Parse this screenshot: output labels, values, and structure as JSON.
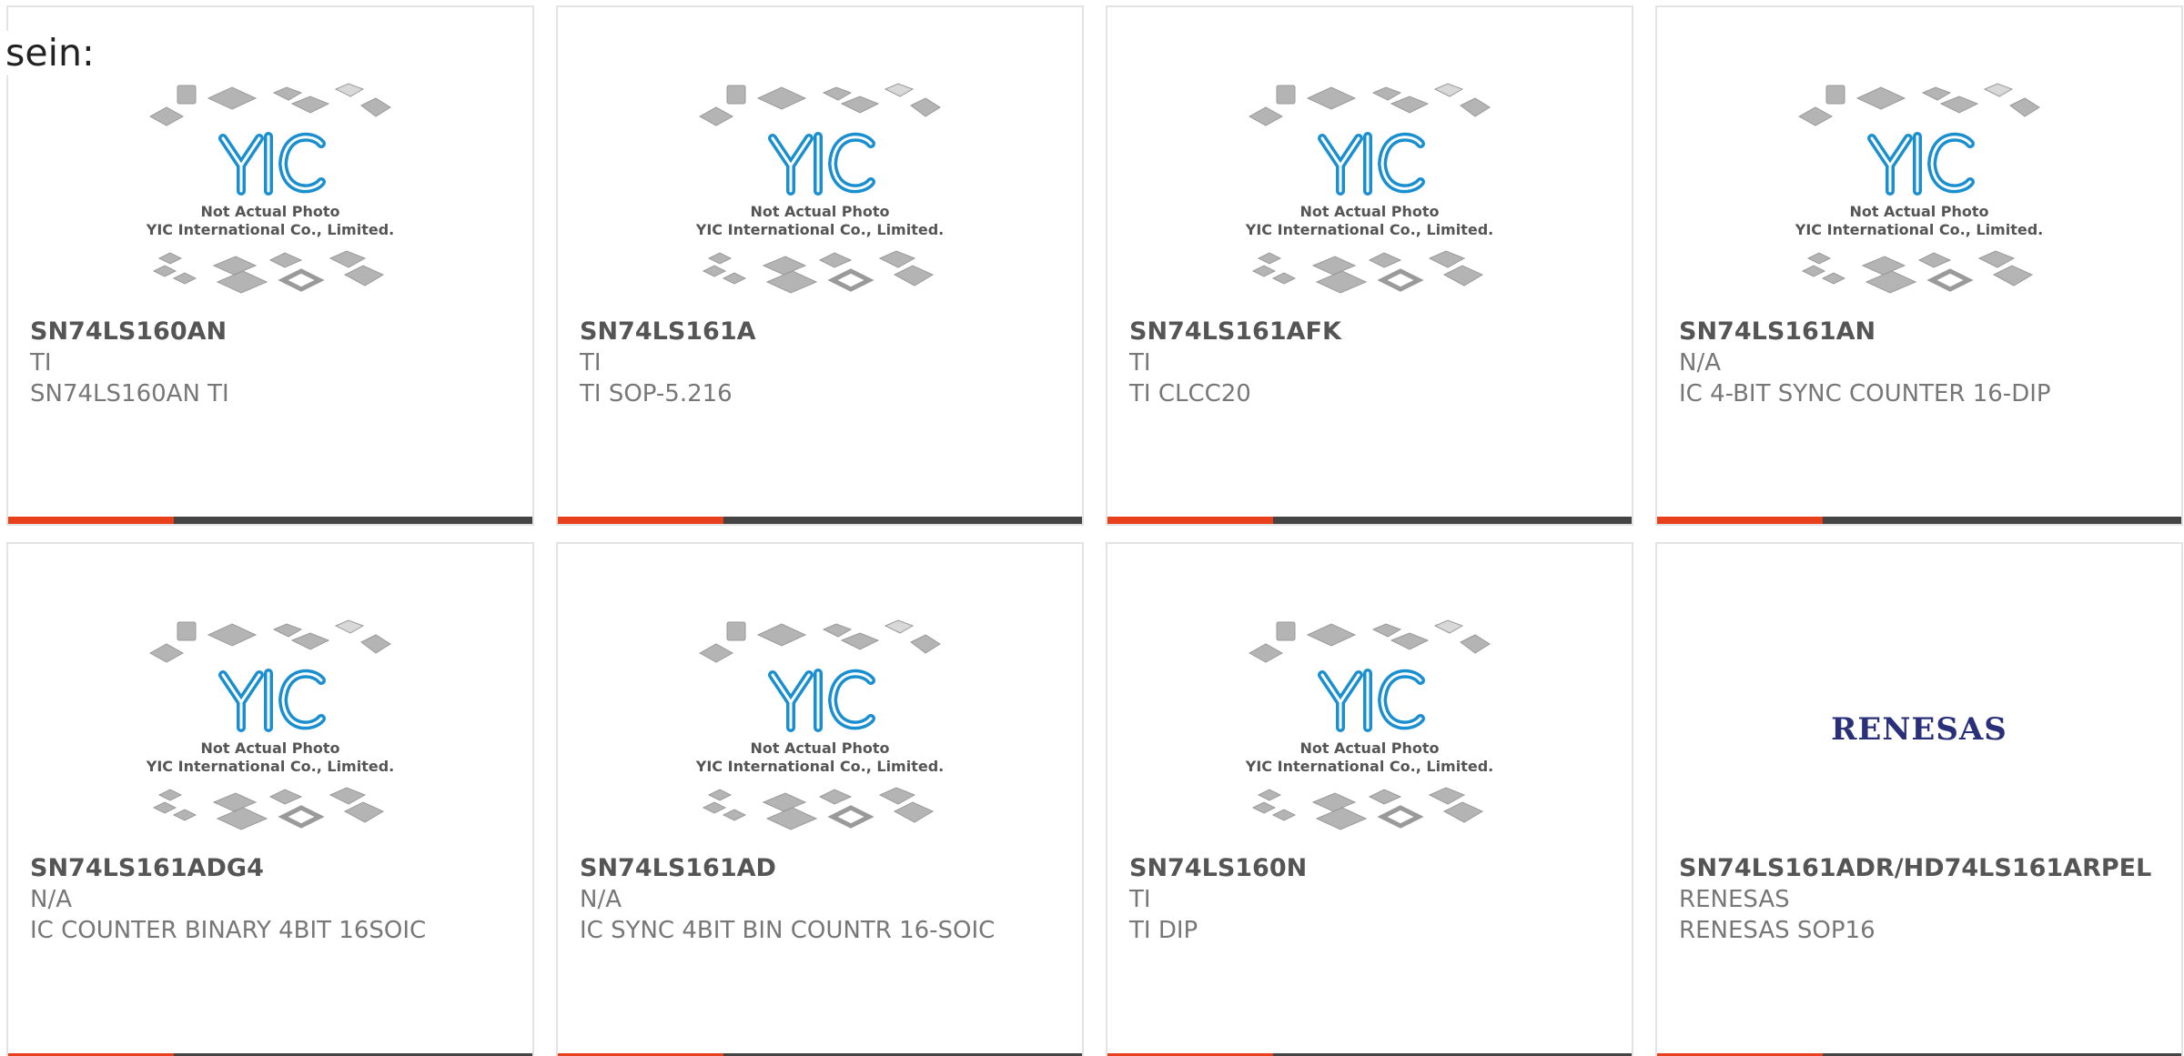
{
  "intro_text": "sein:",
  "placeholder_image": {
    "line1": "Not Actual Photo",
    "line2": "YIC International Co., Limited."
  },
  "colors": {
    "accent": "#e8401c",
    "bar": "#444444",
    "card_border": "#e3e3e3",
    "yic_blue": "#1a8fd0",
    "renesas_blue": "#2a2f7a"
  },
  "products": [
    {
      "part": "SN74LS160AN",
      "manufacturer": "TI",
      "description": "SN74LS160AN TI",
      "image": "yic-placeholder"
    },
    {
      "part": "SN74LS161A",
      "manufacturer": "TI",
      "description": "TI SOP-5.216",
      "image": "yic-placeholder"
    },
    {
      "part": "SN74LS161AFK",
      "manufacturer": "TI",
      "description": "TI CLCC20",
      "image": "yic-placeholder"
    },
    {
      "part": "SN74LS161AN",
      "manufacturer": "N/A",
      "description": "IC 4-BIT SYNC COUNTER 16-DIP",
      "image": "yic-placeholder"
    },
    {
      "part": "SN74LS161ADG4",
      "manufacturer": "N/A",
      "description": "IC COUNTER BINARY 4BIT 16SOIC",
      "image": "yic-placeholder"
    },
    {
      "part": "SN74LS161AD",
      "manufacturer": "N/A",
      "description": "IC SYNC 4BIT BIN COUNTR 16-SOIC",
      "image": "yic-placeholder"
    },
    {
      "part": "SN74LS160N",
      "manufacturer": "TI",
      "description": "TI DIP",
      "image": "yic-placeholder"
    },
    {
      "part": "SN74LS161ADR/HD74LS161ARPEL",
      "manufacturer": "RENESAS",
      "description": "RENESAS SOP16",
      "image": "renesas-logo",
      "logo_text": "RENESAS"
    }
  ]
}
